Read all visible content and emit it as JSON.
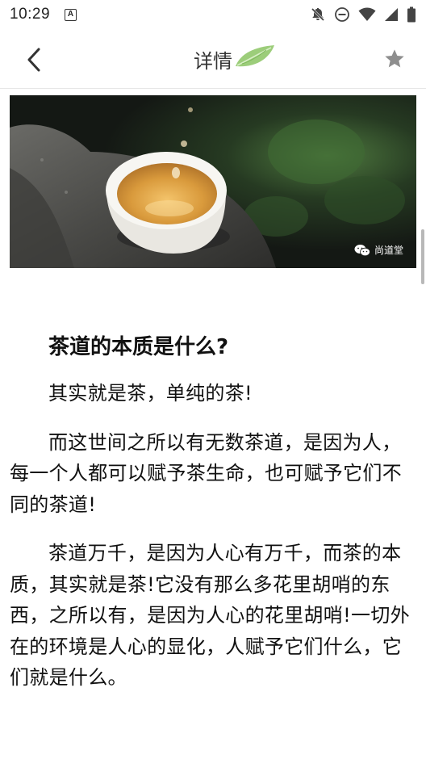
{
  "status_bar": {
    "time": "10:29",
    "notification_icon_letter": "A"
  },
  "header": {
    "title": "详情",
    "back_icon": "chevron-left-icon",
    "favorite_icon": "star-icon"
  },
  "hero_image": {
    "watermark": "尚道堂",
    "watermark_icon": "wechat-icon"
  },
  "article": {
    "heading": "茶道的本质是什么?",
    "paragraphs": [
      "其实就是茶，单纯的茶!",
      "而这世间之所以有无数茶道，是因为人，每一个人都可以赋予茶生命，也可赋予它们不同的茶道!",
      "茶道万千，是因为人心有万千，而茶的本质，其实就是茶!它没有那么多花里胡哨的东西，之所以有，是因为人心的花里胡哨!一切外在的环境是人心的显化，人赋予它们什么，它们就是什么。"
    ]
  },
  "colors": {
    "leaf_green": "#8cc56a",
    "star_gray": "#8e8e8e",
    "divider": "#e6e6e6",
    "text": "#111111"
  }
}
